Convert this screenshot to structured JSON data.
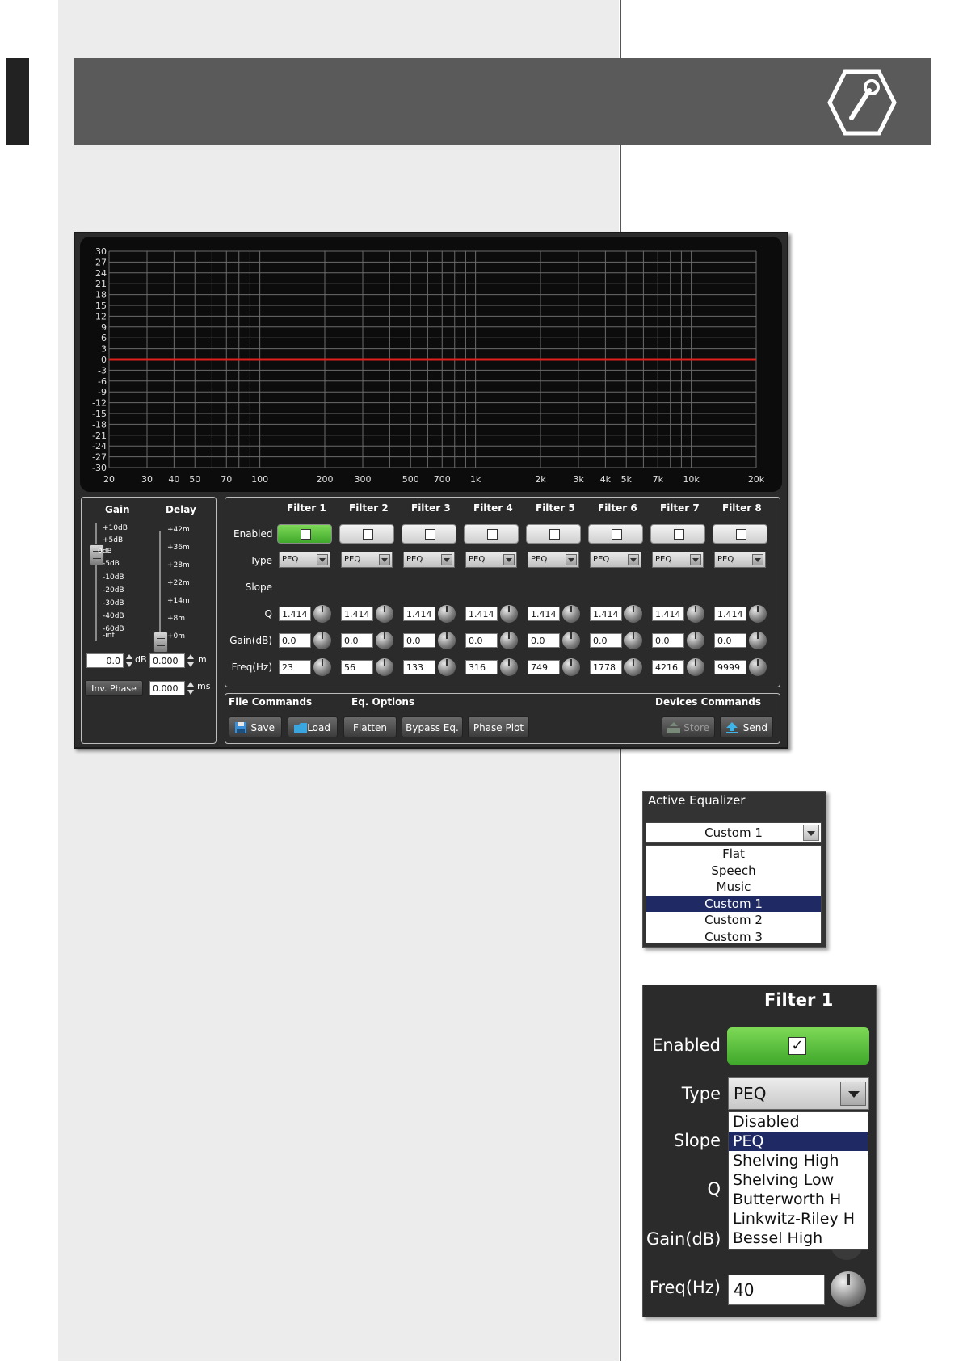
{
  "graph": {
    "y_ticks": [
      "30",
      "27",
      "24",
      "21",
      "18",
      "15",
      "12",
      "9",
      "6",
      "3",
      "0",
      "-3",
      "-6",
      "-9",
      "-12",
      "-15",
      "-18",
      "-21",
      "-24",
      "-27",
      "-30"
    ],
    "x_ticks": [
      {
        "label": "20",
        "hz": 20
      },
      {
        "label": "30",
        "hz": 30
      },
      {
        "label": "40",
        "hz": 40
      },
      {
        "label": "50",
        "hz": 50
      },
      {
        "label": "70",
        "hz": 70
      },
      {
        "label": "100",
        "hz": 100
      },
      {
        "label": "200",
        "hz": 200
      },
      {
        "label": "300",
        "hz": 300
      },
      {
        "label": "500",
        "hz": 500
      },
      {
        "label": "700",
        "hz": 700
      },
      {
        "label": "1k",
        "hz": 1000
      },
      {
        "label": "2k",
        "hz": 2000
      },
      {
        "label": "3k",
        "hz": 3000
      },
      {
        "label": "4k",
        "hz": 4000
      },
      {
        "label": "5k",
        "hz": 5000
      },
      {
        "label": "7k",
        "hz": 7000
      },
      {
        "label": "10k",
        "hz": 10000
      },
      {
        "label": "20k",
        "hz": 20000
      }
    ],
    "response_db": 0,
    "line_color": "#e0201c"
  },
  "gain_delay": {
    "gain_header": "Gain",
    "delay_header": "Delay",
    "gain_scale": [
      "+10dB",
      "+5dB",
      "0dB",
      "-5dB",
      "-10dB",
      "-20dB",
      "-30dB",
      "-40dB",
      "-60dB",
      "-inf"
    ],
    "delay_scale": [
      "+42m",
      "+36m",
      "+28m",
      "+22m",
      "+14m",
      "+8m",
      "+0m"
    ],
    "gain_value": "0.0",
    "gain_unit": "dB",
    "delay_m_value": "0.000",
    "delay_m_unit": "m",
    "inv_phase_label": "Inv. Phase",
    "delay_ms_value": "0.000",
    "delay_ms_unit": "ms"
  },
  "filters": {
    "row_labels": {
      "enabled": "Enabled",
      "type": "Type",
      "slope": "Slope",
      "q": "Q",
      "gain": "Gain(dB)",
      "freq": "Freq(Hz)"
    },
    "columns": [
      {
        "name": "Filter 1",
        "enabled": true,
        "type": "PEQ",
        "q": "1.414",
        "gain": "0.0",
        "freq": "23"
      },
      {
        "name": "Filter 2",
        "enabled": false,
        "type": "PEQ",
        "q": "1.414",
        "gain": "0.0",
        "freq": "56"
      },
      {
        "name": "Filter 3",
        "enabled": false,
        "type": "PEQ",
        "q": "1.414",
        "gain": "0.0",
        "freq": "133"
      },
      {
        "name": "Filter 4",
        "enabled": false,
        "type": "PEQ",
        "q": "1.414",
        "gain": "0.0",
        "freq": "316"
      },
      {
        "name": "Filter 5",
        "enabled": false,
        "type": "PEQ",
        "q": "1.414",
        "gain": "0.0",
        "freq": "749"
      },
      {
        "name": "Filter 6",
        "enabled": false,
        "type": "PEQ",
        "q": "1.414",
        "gain": "0.0",
        "freq": "1778"
      },
      {
        "name": "Filter 7",
        "enabled": false,
        "type": "PEQ",
        "q": "1.414",
        "gain": "0.0",
        "freq": "4216"
      },
      {
        "name": "Filter 8",
        "enabled": false,
        "type": "PEQ",
        "q": "1.414",
        "gain": "0.0",
        "freq": "9999"
      }
    ]
  },
  "commands": {
    "file_header": "File Commands",
    "eq_header": "Eq. Options",
    "devices_header": "Devices Commands",
    "save": "Save",
    "load": "Load",
    "flatten": "Flatten",
    "bypass": "Bypass Eq.",
    "phase_plot": "Phase Plot",
    "store": "Store",
    "send": "Send"
  },
  "active_equalizer": {
    "title": "Active Equalizer",
    "selected": "Custom 1",
    "options": [
      "Flat",
      "Speech",
      "Music",
      "Custom 1",
      "Custom 2",
      "Custom 3"
    ],
    "highlighted_index": 3
  },
  "filter1_zoom": {
    "title": "Filter 1",
    "enabled_label": "Enabled",
    "enabled_mark": "✓",
    "type_label": "Type",
    "type_value": "PEQ",
    "slope_label": "Slope",
    "q_label": "Q",
    "gain_label": "Gain(dB)",
    "freq_label": "Freq(Hz)",
    "freq_value": "40",
    "type_options": [
      "Disabled",
      "PEQ",
      "Shelving High",
      "Shelving Low",
      "Butterworth H",
      "Linkwitz-Riley H",
      "Bessel High"
    ],
    "highlighted_index": 1
  }
}
